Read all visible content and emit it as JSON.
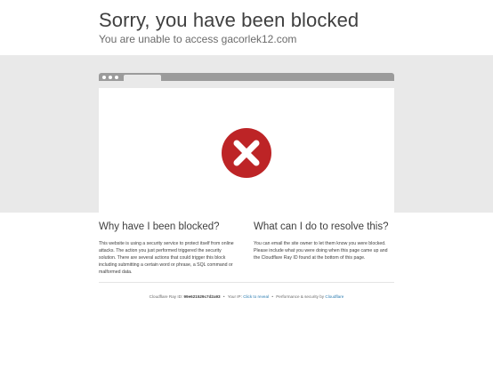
{
  "header": {
    "title": "Sorry, you have been blocked",
    "subtitle": "You are unable to access gacorlek12.com"
  },
  "browser_graphic": {
    "icon": "blocked-x-icon",
    "colors": {
      "icon_red": "#bd2426",
      "bar": "#9b9b9b",
      "band": "#e9e9e9"
    }
  },
  "why": {
    "heading": "Why have I been blocked?",
    "body": "This website is using a security service to protect itself from online attacks. The action you just performed triggered the security solution. There are several actions that could trigger this block including submitting a certain word or phrase, a SQL command or malformed data."
  },
  "resolve": {
    "heading": "What can I do to resolve this?",
    "body": "You can email the site owner to let them know you were blocked. Please include what you were doing when this page came up and the Cloudflare Ray ID found at the bottom of this page."
  },
  "footer": {
    "ray_label": "Cloudflare Ray ID:",
    "ray_id": "99e621529c7d2a93",
    "separator": "•",
    "ip_label": "Your IP:",
    "ip_link": "Click to reveal",
    "perf_label": "Performance & security by",
    "cloudflare_link": "Cloudflare"
  }
}
